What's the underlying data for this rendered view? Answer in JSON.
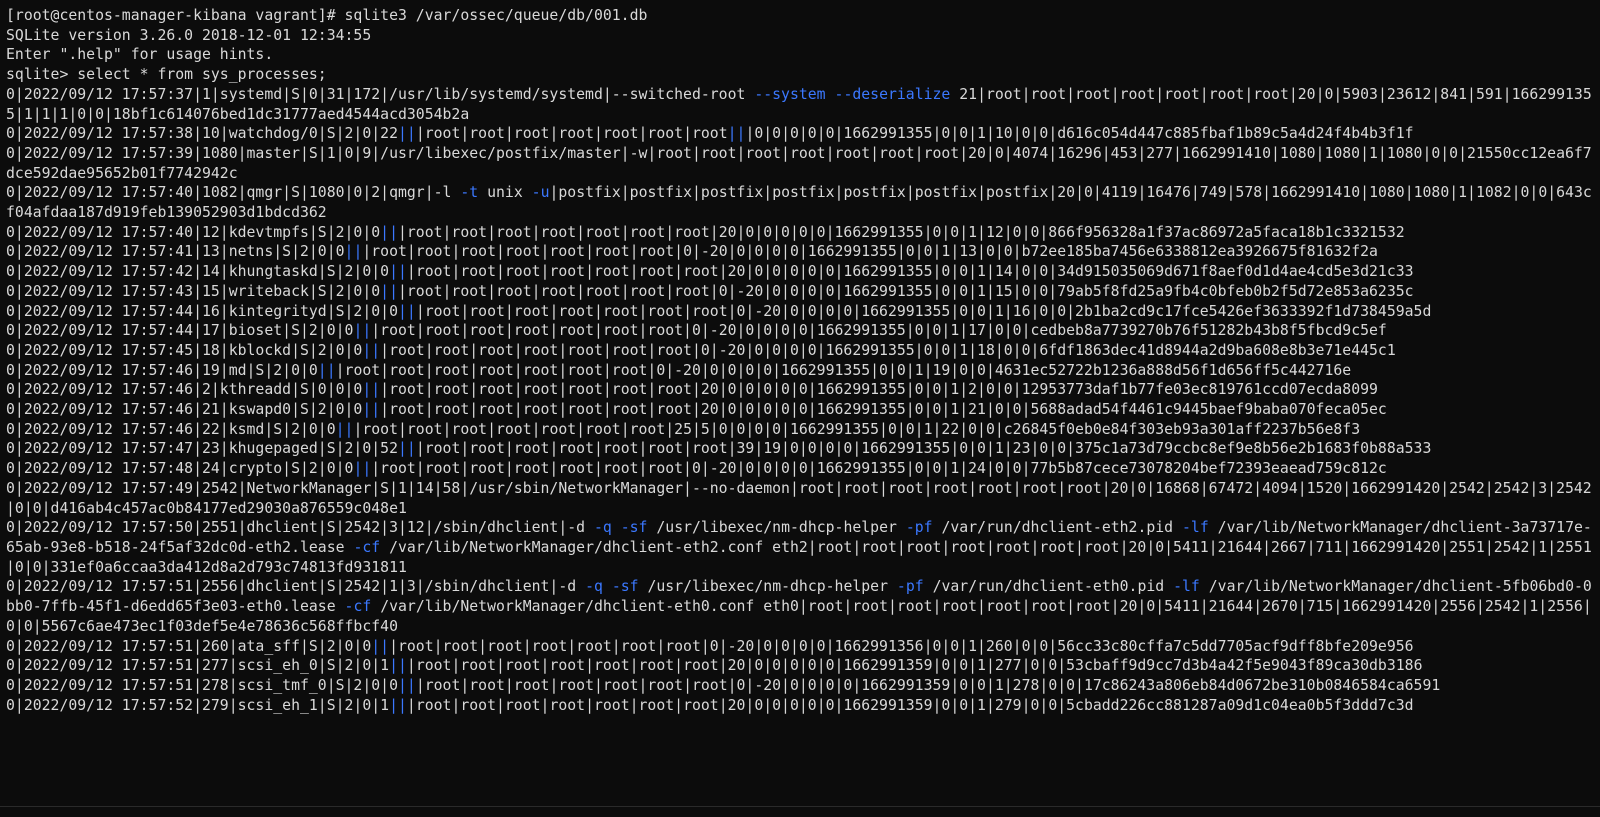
{
  "terminal": {
    "lines": [
      "[root@centos-manager-kibana vagrant]# sqlite3 /var/ossec/queue/db/001.db",
      "SQLite version 3.26.0 2018-12-01 12:34:55",
      "Enter \".help\" for usage hints.",
      "sqlite> select * from sys_processes;",
      "0|2022/09/12 17:57:37|1|systemd|S|0|31|172|/usr/lib/systemd/systemd|--switched-root --system --deserialize 21|root|root|root|root|root|root|root|20|0|5903|23612|841|591|1662991355|1|1|1|0|0|18bf1c614076bed1dc31777aed4544acd3054b2a",
      "0|2022/09/12 17:57:38|10|watchdog/0|S|2|0|22|||root|root|root|root|root|root|root|||0|0|0|0|0|1662991355|0|0|1|10|0|0|d616c054d447c885fbaf1b89c5a4d24f4b4b3f1f",
      "0|2022/09/12 17:57:39|1080|master|S|1|0|9|/usr/libexec/postfix/master|-w|root|root|root|root|root|root|root|20|0|4074|16296|453|277|1662991410|1080|1080|1|1080|0|0|21550cc12ea6f7dce592dae95652b01f7742942c",
      "0|2022/09/12 17:57:40|1082|qmgr|S|1080|0|2|qmgr|-l -t unix -u|postfix|postfix|postfix|postfix|postfix|postfix|postfix|20|0|4119|16476|749|578|1662991410|1080|1080|1|1082|0|0|643cf04afdaa187d919feb139052903d1bdcd362",
      "0|2022/09/12 17:57:40|12|kdevtmpfs|S|2|0|0|||root|root|root|root|root|root|root|20|0|0|0|0|0|1662991355|0|0|1|12|0|0|866f956328a1f37ac86972a5faca18b1c3321532",
      "0|2022/09/12 17:57:41|13|netns|S|2|0|0|||root|root|root|root|root|root|root|0|-20|0|0|0|0|1662991355|0|0|1|13|0|0|b72ee185ba7456e6338812ea3926675f81632f2a",
      "0|2022/09/12 17:57:42|14|khungtaskd|S|2|0|0|||root|root|root|root|root|root|root|20|0|0|0|0|0|1662991355|0|0|1|14|0|0|34d915035069d671f8aef0d1d4ae4cd5e3d21c33",
      "0|2022/09/12 17:57:43|15|writeback|S|2|0|0|||root|root|root|root|root|root|root|0|-20|0|0|0|0|1662991355|0|0|1|15|0|0|79ab5f8fd25a9fb4c0bfeb0b2f5d72e853a6235c",
      "0|2022/09/12 17:57:44|16|kintegrityd|S|2|0|0|||root|root|root|root|root|root|root|0|-20|0|0|0|0|1662991355|0|0|1|16|0|0|2b1ba2cd9c17fce5426ef3633392f1d738459a5d",
      "0|2022/09/12 17:57:44|17|bioset|S|2|0|0|||root|root|root|root|root|root|root|0|-20|0|0|0|0|1662991355|0|0|1|17|0|0|cedbeb8a7739270b76f51282b43b8f5fbcd9c5ef",
      "0|2022/09/12 17:57:45|18|kblockd|S|2|0|0|||root|root|root|root|root|root|root|0|-20|0|0|0|0|1662991355|0|0|1|18|0|0|6fdf1863dec41d8944a2d9ba608e8b3e71e445c1",
      "0|2022/09/12 17:57:46|19|md|S|2|0|0|||root|root|root|root|root|root|root|0|-20|0|0|0|0|1662991355|0|0|1|19|0|0|4631ec52722b1236a888d56f1d656ff5c442716e",
      "0|2022/09/12 17:57:46|2|kthreadd|S|0|0|0|||root|root|root|root|root|root|root|20|0|0|0|0|0|1662991355|0|0|1|2|0|0|12953773daf1b77fe03ec819761ccd07ecda8099",
      "0|2022/09/12 17:57:46|21|kswapd0|S|2|0|0|||root|root|root|root|root|root|root|20|0|0|0|0|0|1662991355|0|0|1|21|0|0|5688adad54f4461c9445baef9baba070feca05ec",
      "0|2022/09/12 17:57:46|22|ksmd|S|2|0|0|||root|root|root|root|root|root|root|25|5|0|0|0|0|1662991355|0|0|1|22|0|0|c26845f0eb0e84f303eb93a301aff2237b56e8f3",
      "0|2022/09/12 17:57:47|23|khugepaged|S|2|0|52|||root|root|root|root|root|root|root|39|19|0|0|0|0|1662991355|0|0|1|23|0|0|375c1a73d79ccbc8ef9e8b56e2b1683f0b88a533",
      "0|2022/09/12 17:57:48|24|crypto|S|2|0|0|||root|root|root|root|root|root|root|0|-20|0|0|0|0|1662991355|0|0|1|24|0|0|77b5b87cece73078204bef72393eaead759c812c",
      "0|2022/09/12 17:57:49|2542|NetworkManager|S|1|14|58|/usr/sbin/NetworkManager|--no-daemon|root|root|root|root|root|root|root|20|0|16868|67472|4094|1520|1662991420|2542|2542|3|2542|0|0|d416ab4c457ac0b84177ed29030a876559c048e1",
      "0|2022/09/12 17:57:50|2551|dhclient|S|2542|3|12|/sbin/dhclient|-d -q -sf /usr/libexec/nm-dhcp-helper -pf /var/run/dhclient-eth2.pid -lf /var/lib/NetworkManager/dhclient-3a73717e-65ab-93e8-b518-24f5af32dc0d-eth2.lease -cf /var/lib/NetworkManager/dhclient-eth2.conf eth2|root|root|root|root|root|root|root|20|0|5411|21644|2667|711|1662991420|2551|2542|1|2551|0|0|331ef0a6ccaa3da412d8a2d793c74813fd931811",
      "0|2022/09/12 17:57:51|2556|dhclient|S|2542|1|3|/sbin/dhclient|-d -q -sf /usr/libexec/nm-dhcp-helper -pf /var/run/dhclient-eth0.pid -lf /var/lib/NetworkManager/dhclient-5fb06bd0-0bb0-7ffb-45f1-d6edd65f3e03-eth0.lease -cf /var/lib/NetworkManager/dhclient-eth0.conf eth0|root|root|root|root|root|root|root|20|0|5411|21644|2670|715|1662991420|2556|2542|1|2556|0|0|5567c6ae473ec1f03def5e4e78636c568ffbcf40",
      "0|2022/09/12 17:57:51|260|ata_sff|S|2|0|0|||root|root|root|root|root|root|root|0|-20|0|0|0|0|1662991356|0|0|1|260|0|0|56cc33c80cffa7c5dd7705acf9dff8bfe209e956",
      "0|2022/09/12 17:57:51|277|scsi_eh_0|S|2|0|1|||root|root|root|root|root|root|root|20|0|0|0|0|0|1662991359|0|0|1|277|0|0|53cbaff9d9cc7d3b4a42f5e9043f89ca30db3186",
      "0|2022/09/12 17:57:51|278|scsi_tmf_0|S|2|0|0|||root|root|root|root|root|root|root|0|-20|0|0|0|0|1662991359|0|0|1|278|0|0|17c86243a806eb84d0672be310b0846584ca6591",
      "0|2022/09/12 17:57:52|279|scsi_eh_1|S|2|0|1|||root|root|root|root|root|root|root|20|0|0|0|0|0|1662991359|0|0|1|279|0|0|5cbadd226cc881287a09d1c04ea0b5f3ddd7c3d"
    ]
  },
  "colors": {
    "background": "#0c0c0c",
    "text": "#d9d9d9",
    "option_highlight": "#3b78ff"
  }
}
